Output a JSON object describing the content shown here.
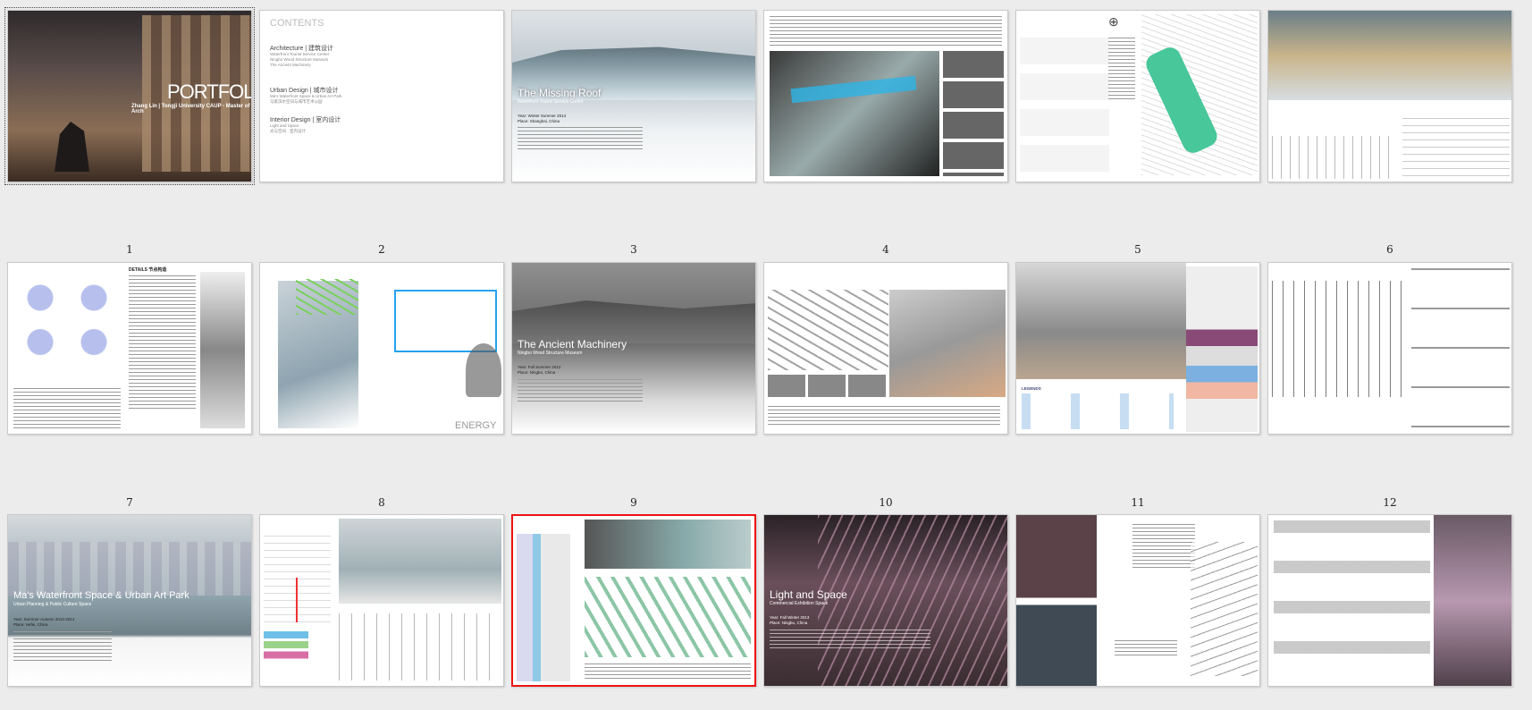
{
  "page_numbers": [
    "1",
    "2",
    "3",
    "4",
    "5",
    "6",
    "7",
    "8",
    "9",
    "10",
    "11",
    "12"
  ],
  "cover": {
    "title": "PORTFOLIO",
    "subtitle": "Zhang Lin | Tongji University CAUP - Master of Arch"
  },
  "contents": {
    "heading": "CONTENTS",
    "items": [
      {
        "title": "Architecture | 建筑设计",
        "sub1": "Waterfront Tourist Service Center",
        "sub2": "Ningbo Wood Structure Museum",
        "sub3": "The Ancient Machinery"
      },
      {
        "title": "Urban Design | 城市设计",
        "sub1": "Ma's Waterfront Space & Urban Art Park",
        "sub2": "马家滨水空间与城市艺术公园"
      },
      {
        "title": "Interior Design | 室内设计",
        "sub1": "Light and Space",
        "sub2": "光与空间 · 室内设计"
      }
    ]
  },
  "project1": {
    "title": "The Missing Roof",
    "subtitle": "Waterfront Tourist Service Center",
    "meta1": "Year: Winter Summer 2014",
    "meta2": "Place: Shanghai, China"
  },
  "project2": {
    "title": "The Ancient Machinery",
    "subtitle": "Ningbo Wood Structure Museum",
    "meta1": "Year: Fall Summer 2012",
    "meta2": "Place: Ningbo, China"
  },
  "project3": {
    "title": "Ma's Waterfront Space & Urban Art Park",
    "subtitle": "Urban Planning & Public Culture Space",
    "meta1": "Year: Summer-Autumn 2013-2014",
    "meta2": "Place: Hefei, China"
  },
  "project4": {
    "title": "Light and Space",
    "subtitle": "Commercial Exhibition Space",
    "meta1": "Year: Fall Winter 2013",
    "meta2": "Place: Ningbo, China"
  },
  "labels": {
    "energy": "ENERGY",
    "details": "DETAILS 节点构造",
    "legends": "LEGENDS"
  }
}
